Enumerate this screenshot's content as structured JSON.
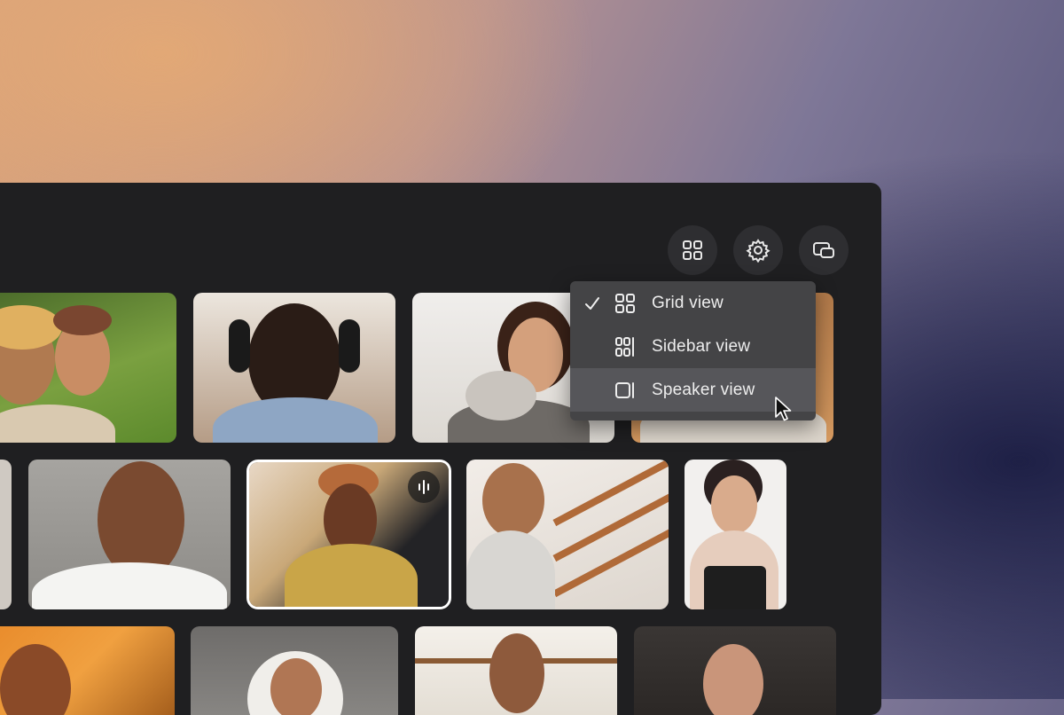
{
  "colors": {
    "panel_bg": "#1f1f21",
    "toolbar_button_bg": "#2e2e31",
    "menu_bg": "#444446",
    "menu_hover_bg": "#56565a",
    "active_tile_border": "#ffffff"
  },
  "toolbar": {
    "buttons": [
      {
        "icon": "grid-icon"
      },
      {
        "icon": "gear-icon"
      },
      {
        "icon": "screen-share-icon"
      }
    ]
  },
  "view_menu": {
    "items": [
      {
        "label": "Grid view",
        "icon": "grid-icon",
        "checked": true
      },
      {
        "label": "Sidebar view",
        "icon": "sidebar-layout-icon",
        "checked": false
      },
      {
        "label": "Speaker view",
        "icon": "speaker-layout-icon",
        "checked": false,
        "hovered": true
      }
    ]
  },
  "participants": {
    "active_speaker_icon": "audio-wave-icon"
  }
}
